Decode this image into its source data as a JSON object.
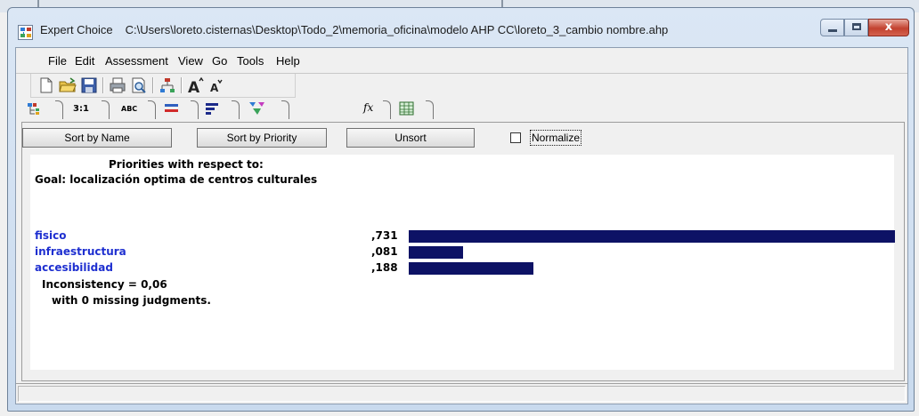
{
  "window": {
    "app_name": "Expert Choice",
    "file_path": "C:\\Users\\loreto.cisternas\\Desktop\\Todo_2\\memoria_oficina\\modelo AHP CC\\loreto_3_cambio nombre.ahp",
    "close_glyph": "x"
  },
  "menu": [
    {
      "label": "File"
    },
    {
      "label": "Edit"
    },
    {
      "label": "Assessment"
    },
    {
      "label": "View"
    },
    {
      "label": "Go"
    },
    {
      "label": "Tools"
    },
    {
      "label": "Help"
    }
  ],
  "toolbar": {
    "icons": [
      "new-file-icon",
      "open-folder-icon",
      "save-icon",
      "print-icon",
      "print-preview-icon",
      "tree-icon",
      "font-increase-icon",
      "font-decrease-icon"
    ]
  },
  "tabs": [
    {
      "icon": "tree-view-icon"
    },
    {
      "label": "3:1"
    },
    {
      "label": "ABC"
    },
    {
      "icon": "graphic-icon"
    },
    {
      "icon": "bar-chart-icon"
    },
    {
      "icon": "funnel-icon"
    },
    {
      "label": "fx"
    },
    {
      "icon": "spreadsheet-icon"
    }
  ],
  "buttons": {
    "sort_by_name": "Sort by Name",
    "sort_by_priority": "Sort by Priority",
    "unsort": "Unsort",
    "normalize": "Normalize"
  },
  "normalize_checked": false,
  "results": {
    "heading": "Priorities with respect to:",
    "goal": "Goal: localización optima de centros culturales",
    "items": [
      {
        "name": "fisico",
        "value": ",731",
        "priority": 0.731
      },
      {
        "name": "infraestructura",
        "value": ",081",
        "priority": 0.081
      },
      {
        "name": "accesibilidad",
        "value": ",188",
        "priority": 0.188
      }
    ],
    "inconsistency": "Inconsistency = 0,06",
    "missing": "with 0  missing judgments."
  },
  "colors": {
    "bar": "#0d1265",
    "criterion_text": "#1e2fd0"
  }
}
